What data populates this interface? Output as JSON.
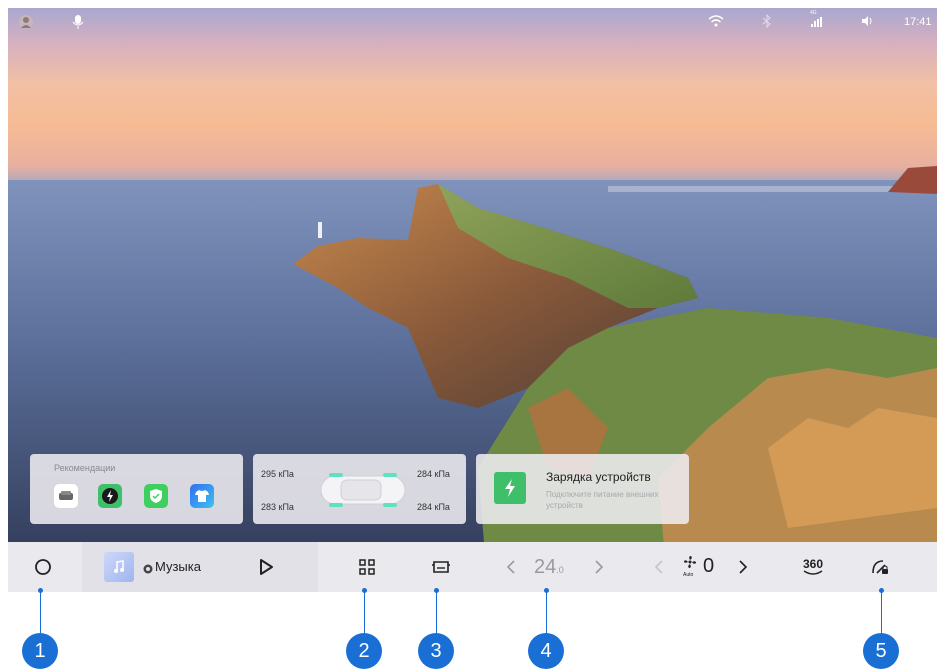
{
  "status_bar": {
    "time": "17:41",
    "left_icons": [
      "avatar-icon",
      "microphone-icon"
    ],
    "right_icons": [
      "wifi-icon",
      "bluetooth-icon",
      "cellular-signal-icon",
      "volume-icon"
    ],
    "signal_label": "4G"
  },
  "widgets": {
    "recommendations": {
      "title": "Рекомендации",
      "icons": [
        "car-icon",
        "lightning-icon",
        "shield-icon",
        "tshirt-icon"
      ]
    },
    "tire_pressure": {
      "front_left": "295 кПа",
      "front_right": "284 кПа",
      "rear_left": "283 кПа",
      "rear_right": "284 кПа"
    },
    "charging": {
      "title": "Зарядка устройств",
      "subtitle": "Подключите питание внешних устройств",
      "accent": "#3fbf6a"
    }
  },
  "dock": {
    "home_icon": "circle-home-icon",
    "music_label": "Музыка",
    "music_source_icon": "netease-icon",
    "apps_icon": "grid-icon",
    "car_view_icon": "car-front-icon",
    "temperature": {
      "value": "24",
      "decimal": ".0"
    },
    "fan": {
      "mode": "Auto",
      "level": "0"
    },
    "camera_label": "360",
    "driving_mode_icon": "steering-lock-icon"
  },
  "callouts": [
    "1",
    "2",
    "3",
    "4",
    "5"
  ],
  "colors": {
    "callout": "#1a6fd4",
    "dock": "#e9e9ee",
    "charge_green": "#3fbf6a",
    "tire_glow": "#5fe0c0"
  }
}
